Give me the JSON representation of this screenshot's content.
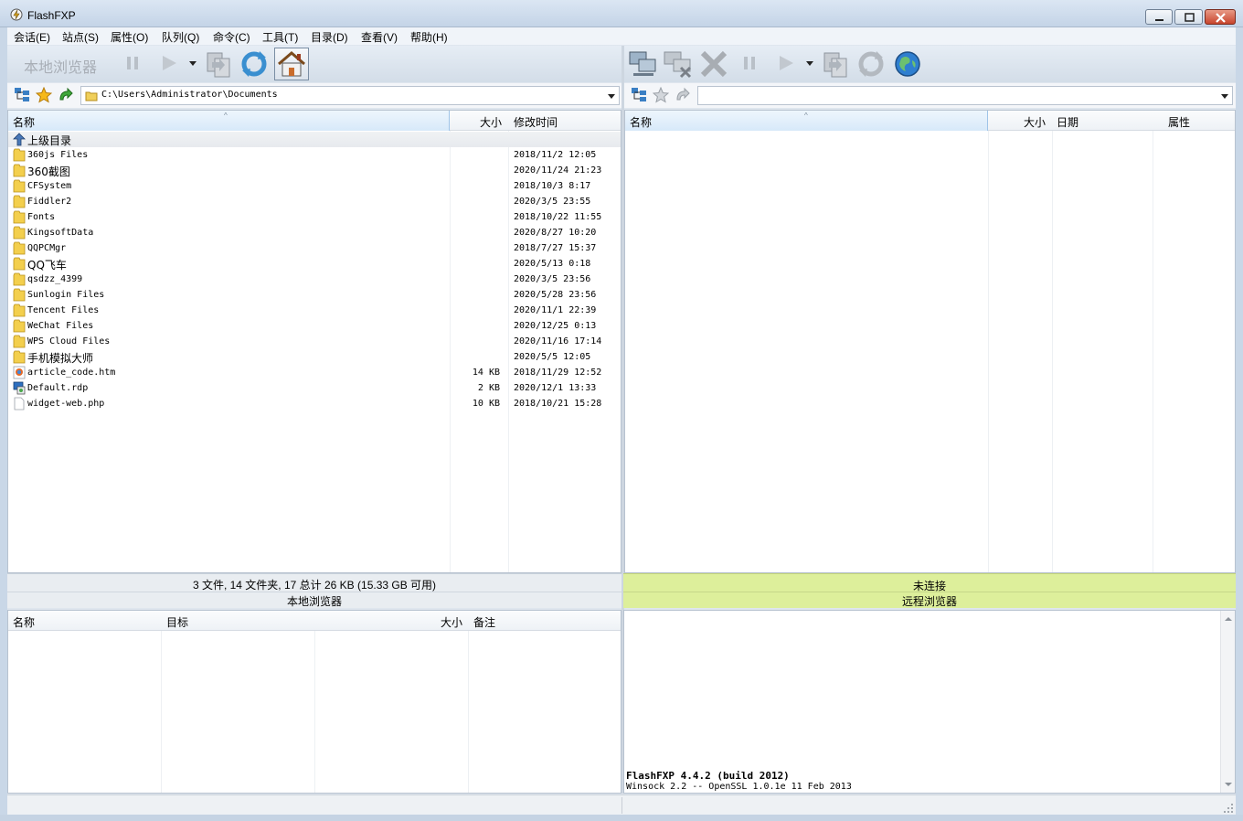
{
  "window": {
    "title": "FlashFXP",
    "icon": "lightning-icon"
  },
  "menu": [
    "会话(E)",
    "站点(S)",
    "属性(O)",
    "队列(Q)",
    "命令(C)",
    "工具(T)",
    "目录(D)",
    "查看(V)",
    "帮助(H)"
  ],
  "left_toolbar": {
    "label": "本地浏览器",
    "icons": [
      "pause-icon",
      "play-icon",
      "dropdown-arrow-icon",
      "transfer-icon",
      "refresh-icon",
      "home-icon"
    ]
  },
  "right_toolbar": {
    "icons": [
      "connect-icon",
      "disconnect-icon",
      "abort-icon",
      "pause-icon",
      "play-icon",
      "dropdown-arrow-icon",
      "transfer-icon",
      "refresh-icon",
      "globe-icon"
    ]
  },
  "left_address": {
    "path": "C:\\Users\\Administrator\\Documents",
    "icons": [
      "tree-view-icon",
      "favorites-star-icon",
      "go-up-icon",
      "folder-icon"
    ]
  },
  "right_address": {
    "path": "",
    "icons": [
      "tree-view-icon",
      "favorites-star-icon",
      "go-up-icon"
    ]
  },
  "left_list": {
    "columns": [
      "名称",
      "大小",
      "修改时间"
    ],
    "parent_label": "上级目录",
    "rows": [
      {
        "name": "360js Files",
        "size": "",
        "date": "2018/11/2 12:05",
        "type": "folder"
      },
      {
        "name": "360截图",
        "size": "",
        "date": "2020/11/24 21:23",
        "type": "folder"
      },
      {
        "name": "CFSystem",
        "size": "",
        "date": "2018/10/3 8:17",
        "type": "folder"
      },
      {
        "name": "Fiddler2",
        "size": "",
        "date": "2020/3/5 23:55",
        "type": "folder"
      },
      {
        "name": "Fonts",
        "size": "",
        "date": "2018/10/22 11:55",
        "type": "folder"
      },
      {
        "name": "KingsoftData",
        "size": "",
        "date": "2020/8/27 10:20",
        "type": "folder"
      },
      {
        "name": "QQPCMgr",
        "size": "",
        "date": "2018/7/27 15:37",
        "type": "folder"
      },
      {
        "name": "QQ飞车",
        "size": "",
        "date": "2020/5/13 0:18",
        "type": "folder"
      },
      {
        "name": "qsdzz_4399",
        "size": "",
        "date": "2020/3/5 23:56",
        "type": "folder"
      },
      {
        "name": "Sunlogin Files",
        "size": "",
        "date": "2020/5/28 23:56",
        "type": "folder"
      },
      {
        "name": "Tencent Files",
        "size": "",
        "date": "2020/11/1 22:39",
        "type": "folder"
      },
      {
        "name": "WeChat Files",
        "size": "",
        "date": "2020/12/25 0:13",
        "type": "folder"
      },
      {
        "name": "WPS Cloud Files",
        "size": "",
        "date": "2020/11/16 17:14",
        "type": "folder"
      },
      {
        "name": "手机模拟大师",
        "size": "",
        "date": "2020/5/5 12:05",
        "type": "folder"
      },
      {
        "name": "article_code.htm",
        "size": "14 KB",
        "date": "2018/11/29 12:52",
        "type": "html"
      },
      {
        "name": "Default.rdp",
        "size": "2 KB",
        "date": "2020/12/1 13:33",
        "type": "rdp"
      },
      {
        "name": "widget-web.php",
        "size": "10 KB",
        "date": "2018/10/21 15:28",
        "type": "file"
      }
    ]
  },
  "right_list": {
    "columns": [
      "名称",
      "大小",
      "日期",
      "属性"
    ]
  },
  "left_status": {
    "summary": "3 文件, 14 文件夹, 17 总计 26 KB (15.33 GB 可用)",
    "label": "本地浏览器"
  },
  "right_status": {
    "summary": "未连接",
    "label": "远程浏览器"
  },
  "queue": {
    "columns": [
      "名称",
      "目标",
      "大小",
      "备注"
    ]
  },
  "log": {
    "line1": "FlashFXP 4.4.2 (build 2012)",
    "line2": "Winsock 2.2 -- OpenSSL 1.0.1e 11 Feb 2013"
  }
}
